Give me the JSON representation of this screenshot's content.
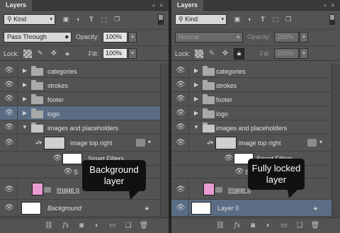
{
  "left": {
    "tab": "Layers",
    "tab_controls": "»  ≡",
    "kind": "Kind",
    "blend_mode": "Pass Through",
    "opacity_label": "Opacity:",
    "opacity_value": "100%",
    "lock_label": "Lock:",
    "fill_label": "Fill:",
    "fill_value": "100%",
    "layers": {
      "categories": "categories",
      "strokes": "strokes",
      "footer": "footer",
      "logo": "logo",
      "images_and_placeholders": "images and placeholders",
      "image_top_right": "image top right",
      "smart_filters": "Smart Filters",
      "sub_filter": "S",
      "image_placeholder": "image p",
      "background": "Background"
    },
    "tooltip_line1": "Background",
    "tooltip_line2": "layer"
  },
  "right": {
    "tab": "Layers",
    "tab_controls": "»  ≡",
    "kind": "Kind",
    "blend_mode": "Normal",
    "opacity_label": "Opacity:",
    "opacity_value": "100%",
    "lock_label": "Lock:",
    "fill_label": "Fill:",
    "fill_value": "100%",
    "layers": {
      "categories": "categories",
      "strokes": "strokes",
      "footer": "footer",
      "logo": "logo",
      "images_and_placeholders": "images and placeholders",
      "image_top_right": "image top right",
      "smart_filters": "Smart Filters",
      "sub_filter": "S",
      "image_placeholder": "image p",
      "layer0": "Layer 0"
    },
    "tooltip_line1": "Fully locked",
    "tooltip_line2": "layer"
  },
  "colors": {
    "panel_bg": "#535353",
    "selected_row": "#5b6d84",
    "pink_thumb": "#e99ad0",
    "tooltip_bg": "#111111"
  },
  "icons": {
    "eye": "eye-icon",
    "folder": "folder-icon",
    "lock": "padlock-icon",
    "chain": "link-icon",
    "fx": "fx-icon",
    "mask": "mask-icon",
    "adjust": "adjustment-icon",
    "group": "new-group-icon",
    "new": "new-layer-icon",
    "trash": "trash-icon"
  }
}
